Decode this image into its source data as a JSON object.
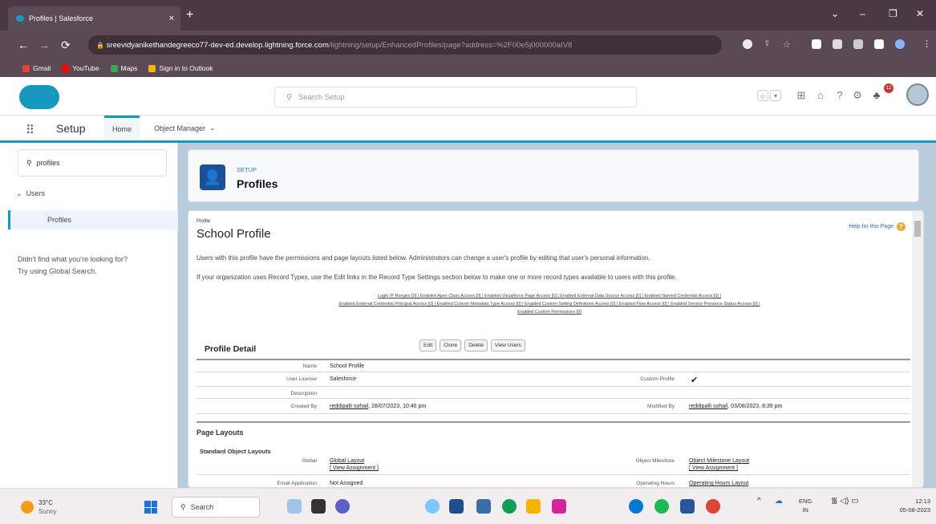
{
  "browser": {
    "tab_title": "Profiles | Salesforce",
    "tab_close": "×",
    "new_tab": "+",
    "url_main": "sreevidyanikethandegreeco77-dev-ed.develop.lightning.force.com",
    "url_path": "/lightning/setup/EnhancedProfiles/page?address=%2F00e5j000000aIV8",
    "window_controls": [
      "⌄",
      "–",
      "❐",
      "✕"
    ],
    "bookmarks": [
      {
        "label": "Gmail",
        "color": "#ea4335"
      },
      {
        "label": "YouTube",
        "color": "#ff0000"
      },
      {
        "label": "Maps",
        "color": "#34a853"
      },
      {
        "label": "Sign in to Outlook",
        "color": "#f4b400"
      }
    ]
  },
  "header": {
    "search_placeholder": "Search Setup",
    "notification_count": "12"
  },
  "nav": {
    "app_name": "Setup",
    "tabs": [
      {
        "label": "Home"
      },
      {
        "label": "Object Manager"
      }
    ]
  },
  "sidebar": {
    "quick_find": "profiles",
    "section": "Users",
    "item": "Profiles",
    "not_found_1": "Didn't find what you're looking for?",
    "not_found_2": "Try using Global Search."
  },
  "page": {
    "eyebrow": "SETUP",
    "title": "Profiles"
  },
  "profile": {
    "type_label": "Profile",
    "name": "School Profile",
    "help_link": "Help for this Page",
    "intro_1": "Users with this profile have the permissions and page layouts listed below. Administrators can change a user's profile by editing that user's personal information.",
    "intro_2": "If your organization uses Record Types, use the Edit links in the Record Type Settings section below to make one or more record types available to users with this profile.",
    "links_line_1": "Login IP Ranges [0]  |  Enabled Apex Class Access [0]  |  Enabled Visualforce Page Access [0]  |  Enabled External Data Source Access [0]  |  Enabled Named Credential Access [0]  |",
    "links_line_2": "Enabled External Credential Principal Access [0]  |  Enabled Custom Metadata Type Access [0]  |  Enabled Custom Setting Definitions Access [0]  |  Enabled Flow Access [0]  |  Enabled Service Presence Status Access [0]  |",
    "links_line_3": "Enabled Custom Permissions [0]",
    "detail_title": "Profile Detail",
    "buttons": [
      "Edit",
      "Clone",
      "Delete",
      "View Users"
    ],
    "fields": {
      "name_label": "Name",
      "name_value": "School Profile",
      "license_label": "User License",
      "license_value": "Salesforce",
      "custom_label": "Custom Profile",
      "custom_value": "✔",
      "desc_label": "Description",
      "created_label": "Created By",
      "created_user": "reddipalli sohail",
      "created_date": ", 28/07/2023, 10:46 pm",
      "modified_label": "Modified By",
      "modified_user": "reddipalli sohail",
      "modified_date": ", 03/08/2023, 8:39 pm"
    },
    "page_layouts_title": "Page Layouts",
    "standard_layouts_title": "Standard Object Layouts",
    "layouts": {
      "global_label": "Global",
      "global_value": "Global Layout",
      "view_assignment": "[ View Assignment ]",
      "milestone_label": "Object Milestone",
      "milestone_value": "Object Milestone Layout",
      "email_label": "Email Application",
      "email_value": "Not Assigned",
      "ops_label": "Operating Hours",
      "ops_value": "Operating Hours Layout"
    }
  },
  "taskbar": {
    "temp": "33°C",
    "weather": "Sunny",
    "search": "Search",
    "lang_1": "ENG",
    "lang_2": "IN",
    "time": "12:13",
    "date": "05-08-2023"
  }
}
